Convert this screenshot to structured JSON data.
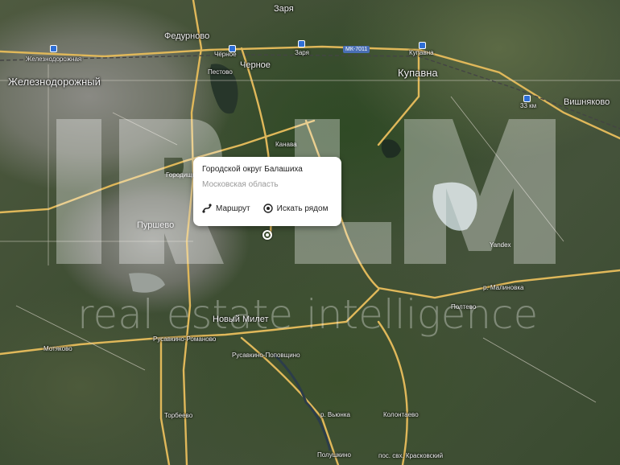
{
  "map": {
    "places": {
      "zarya": "Заря",
      "fedurnovo": "Федурново",
      "zheleznodorozhny": "Железнодорожный",
      "station_zheleznodorozhnaya": "Железнодорожная",
      "chernoe": "Чёрное",
      "chernoe2": "Черное",
      "zarya_station": "Заря",
      "kupavna_station": "Купавна",
      "kupavna": "Купавна",
      "vishnyakovo": "Вишняково",
      "km33": "33 км",
      "pestovo": "Пестово",
      "purshevo": "Пуршево",
      "gorodishchi": "Городищи",
      "novy_milet": "Новый Милет",
      "motyakovo": "Мотяково",
      "rusavkino_romanovo": "Русавкино-Романово",
      "rusavkino_popovshchino": "Русавкино-Поповщино",
      "torbeevo": "Торбеево",
      "koltevo": "Полтево",
      "kolnevo": "Колонтаево",
      "polushkino": "Полушкино",
      "krasnoe": "пос. свх. Красковский",
      "vyunka": "р. Вьюнка",
      "malinovka": "р. Малиновка",
      "kanava": "Канава"
    },
    "roads": {
      "mk7011": "МК-7011"
    }
  },
  "watermark": {
    "text": "real estate intelligence"
  },
  "popup": {
    "title": "Городской округ Балашиха",
    "subtitle": "Московская область",
    "route_label": "Маршрут",
    "search_near_label": "Искать рядом"
  },
  "attribution": "Yandex",
  "colors": {
    "road": "#e0b85a",
    "accent": "#2f6fd6"
  }
}
